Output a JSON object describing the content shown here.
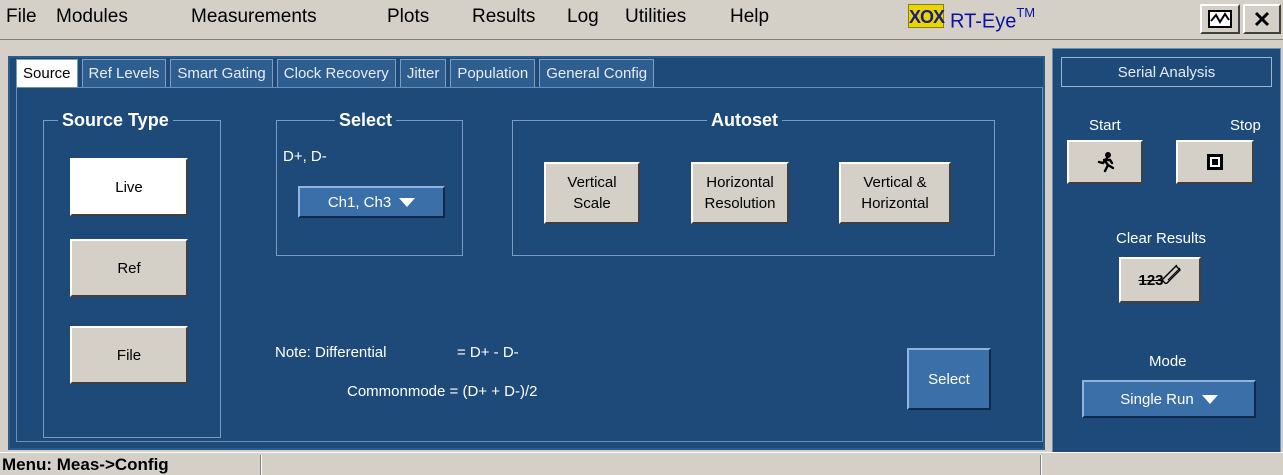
{
  "menu": {
    "items": [
      "File",
      "Modules",
      "Measurements",
      "Plots",
      "Results",
      "Log",
      "Utilities",
      "Help"
    ]
  },
  "app": {
    "logo_text": "XOX",
    "title": "RT-Eye",
    "trademark": "TM"
  },
  "tabs": [
    "Source",
    "Ref Levels",
    "Smart Gating",
    "Clock Recovery",
    "Jitter",
    "Population",
    "General Config"
  ],
  "active_tab": "Source",
  "source_type": {
    "label": "Source Type",
    "buttons": [
      "Live",
      "Ref",
      "File"
    ],
    "selected": "Live"
  },
  "select_group": {
    "label": "Select",
    "field_label": "D+, D-",
    "dropdown_value": "Ch1, Ch3"
  },
  "autoset": {
    "label": "Autoset",
    "buttons": [
      {
        "line1": "Vertical",
        "line2": "Scale"
      },
      {
        "line1": "Horizontal",
        "line2": "Resolution"
      },
      {
        "line1": "Vertical &",
        "line2": "Horizontal"
      }
    ]
  },
  "note": {
    "line1_left": "Note: Differential",
    "line1_right": "= D+ - D-",
    "line2": "Commonmode = (D+ + D-)/2"
  },
  "select_button": "Select",
  "right_panel": {
    "title": "Serial Analysis",
    "start_label": "Start",
    "stop_label": "Stop",
    "clear_label": "Clear Results",
    "clear_icon_text": "123",
    "mode_label": "Mode",
    "mode_value": "Single Run"
  },
  "status": {
    "text": "Menu: Meas->Config"
  }
}
